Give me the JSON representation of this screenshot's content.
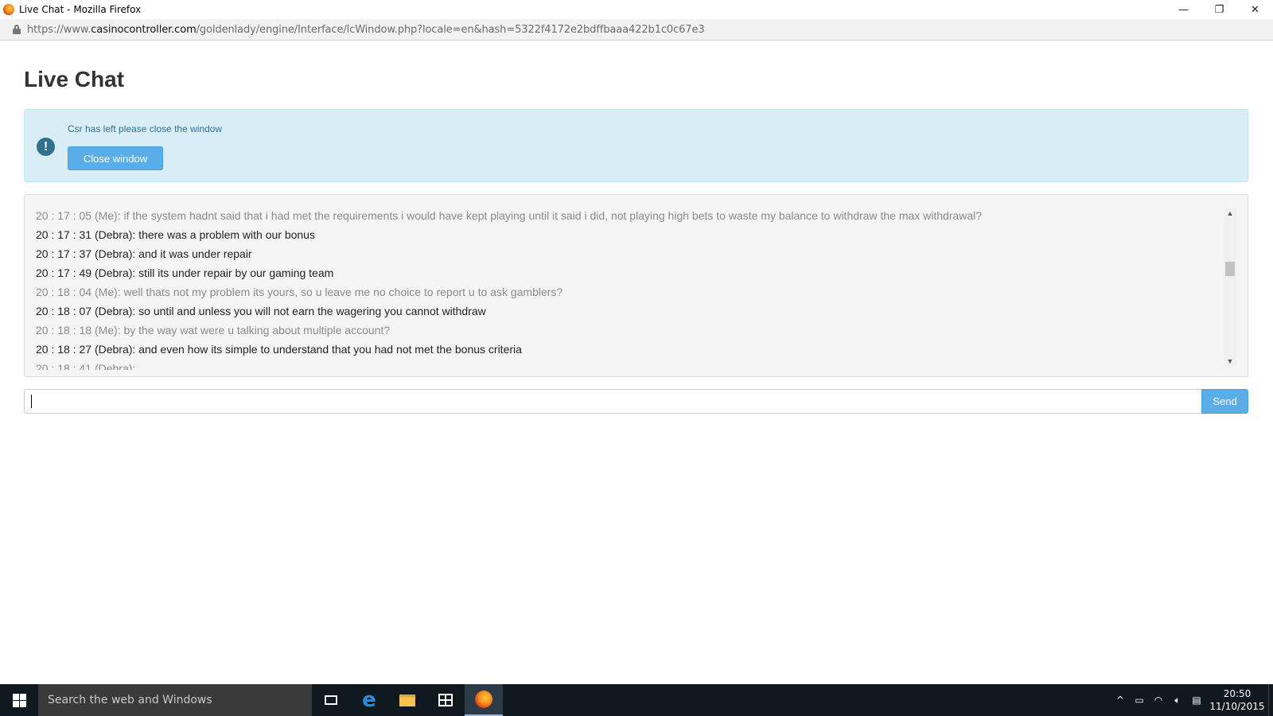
{
  "window": {
    "title": "Live Chat - Mozilla Firefox",
    "minimize_glyph": "—",
    "restore_glyph": "❐",
    "close_glyph": "✕"
  },
  "urlbar": {
    "prefix": "https://www.",
    "domain": "casinocontroller.com",
    "path": "/goldenlady/engine/Interface/lcWindow.php?locale=en&hash=5322f4172e2bdffbaaa422b1c0c67e3"
  },
  "page": {
    "title": "Live Chat"
  },
  "alert": {
    "icon": "!",
    "message": "Csr has left please close the window",
    "close_button": "Close window"
  },
  "chat": {
    "messages": [
      {
        "text": "20 : 17 : 05 (Me): if the system hadnt said that i had met the requirements i would have kept playing until it said i did, not playing high bets to waste my balance to withdraw the max withdrawal?",
        "sender": "me"
      },
      {
        "text": "20 : 17 : 31 (Debra): there was a problem with our bonus",
        "sender": "csr"
      },
      {
        "text": "20 : 17 : 37 (Debra): and it was under repair",
        "sender": "csr"
      },
      {
        "text": "20 : 17 : 49 (Debra): still its under repair by our gaming team",
        "sender": "csr"
      },
      {
        "text": "20 : 18 : 04 (Me): well thats not my problem its yours, so u leave me no choice to report u to ask gamblers?",
        "sender": "me"
      },
      {
        "text": "20 : 18 : 07 (Debra): so until and unless you will not earn the wagering you cannot withdraw",
        "sender": "csr"
      },
      {
        "text": "20 : 18 : 18 (Me): by the way wat were u talking about multiple account?",
        "sender": "me"
      },
      {
        "text": "20 : 18 : 27 (Debra): and even how its simple to understand that you had not met the bonus criteria",
        "sender": "csr"
      }
    ],
    "partial_line": "20 : 18 : 41 (Debra): ...",
    "scroll_up": "▲",
    "scroll_down": "▼"
  },
  "composer": {
    "value": "",
    "send_label": "Send"
  },
  "taskbar": {
    "search_placeholder": "Search the web and Windows",
    "tray_chevron": "^",
    "time": "20:50",
    "date": "11/10/2015"
  }
}
